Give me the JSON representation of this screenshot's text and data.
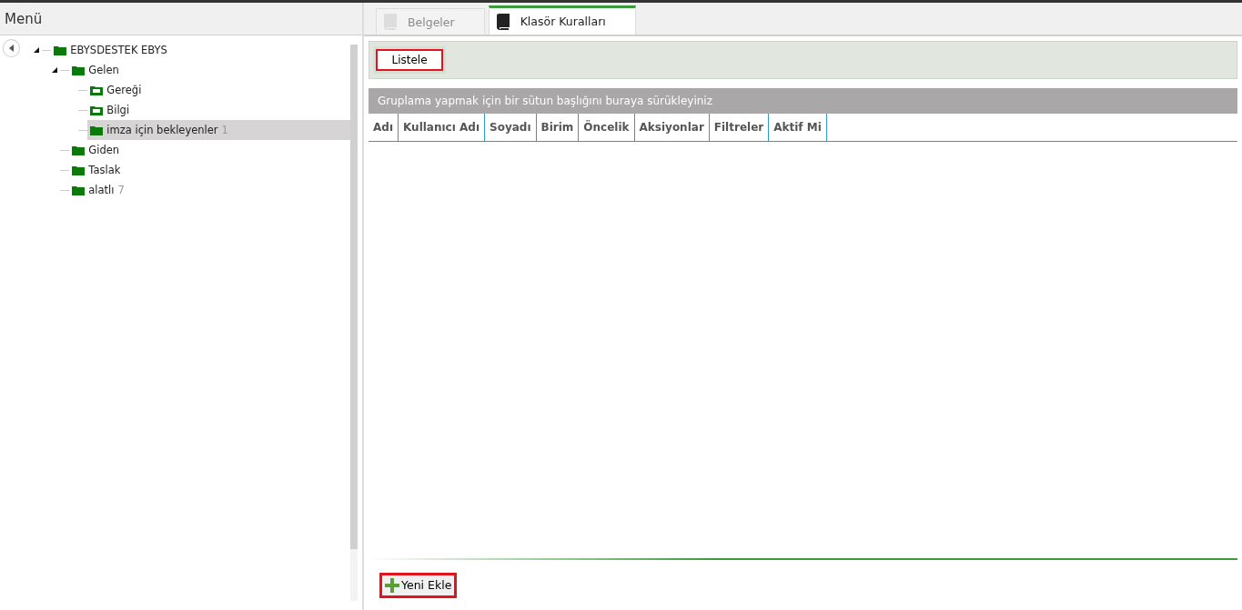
{
  "sidebar": {
    "title": "Menü",
    "tree": [
      {
        "label": "EBYSDESTEK EBYS",
        "kind": "folder",
        "expanded": true,
        "selected": false,
        "children": [
          {
            "label": "Gelen",
            "kind": "folder",
            "expanded": true,
            "selected": false,
            "children": [
              {
                "label": "Gereği",
                "kind": "inbox",
                "selected": false
              },
              {
                "label": "Bilgi",
                "kind": "inbox",
                "selected": false
              },
              {
                "label": "imza için bekleyenler",
                "count": "1",
                "kind": "folder",
                "selected": true
              }
            ]
          },
          {
            "label": "Giden",
            "kind": "folder",
            "selected": false
          },
          {
            "label": "Taslak",
            "kind": "folder",
            "selected": false
          },
          {
            "label": "alatlı",
            "count": "7",
            "kind": "folder",
            "selected": false
          }
        ]
      }
    ]
  },
  "tabs": [
    {
      "label": "Belgeler",
      "selected": false
    },
    {
      "label": "Klasör Kuralları",
      "selected": true
    }
  ],
  "toolbar": {
    "button": "Listele"
  },
  "grid": {
    "group_hint": "Gruplama yapmak için bir sütun başlığını buraya sürükleyiniz",
    "columns": [
      "Adı",
      "Kullanıcı Adı",
      "Soyadı",
      "Birim",
      "Öncelik",
      "Aksiyonlar",
      "Filtreler",
      "Aktif Mi"
    ]
  },
  "add_button": "Yeni Ekle"
}
